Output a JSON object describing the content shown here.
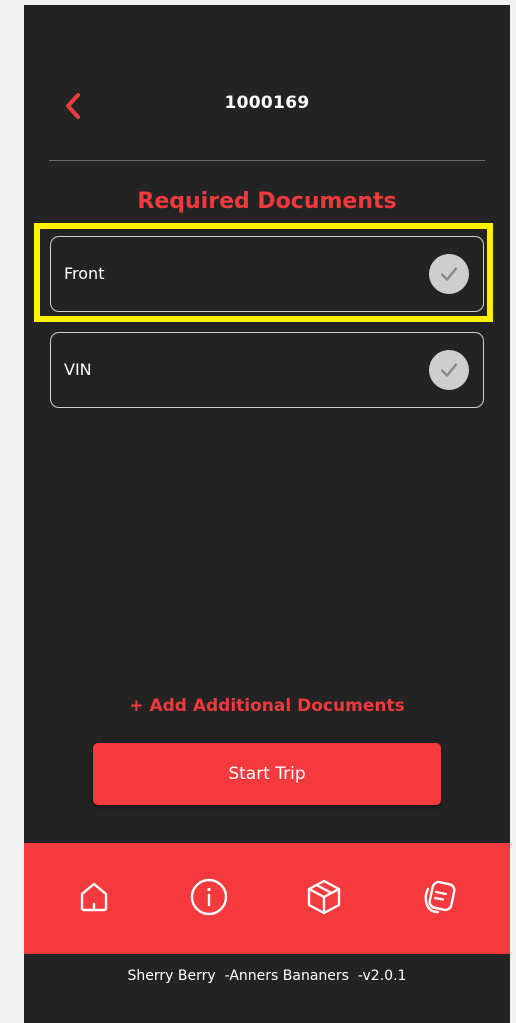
{
  "header": {
    "title": "1000169",
    "back_icon": "chevron-left-icon"
  },
  "section": {
    "title": "Required Documents"
  },
  "documents": [
    {
      "label": "Front",
      "status_icon": "check-circle-icon",
      "highlighted": true
    },
    {
      "label": "VIN",
      "status_icon": "check-circle-icon",
      "highlighted": false
    }
  ],
  "actions": {
    "add_documents_label": "+ Add Additional Documents",
    "start_trip_label": "Start Trip"
  },
  "tab_bar": {
    "items": [
      {
        "icon": "home-icon"
      },
      {
        "icon": "info-icon"
      },
      {
        "icon": "package-icon"
      },
      {
        "icon": "notes-icon"
      }
    ]
  },
  "footer": {
    "text": "Sherry Berry  -Anners Bananers  -v2.0.1"
  },
  "colors": {
    "accent": "#f43a3d",
    "background": "#232323",
    "highlight": "#fff200"
  }
}
